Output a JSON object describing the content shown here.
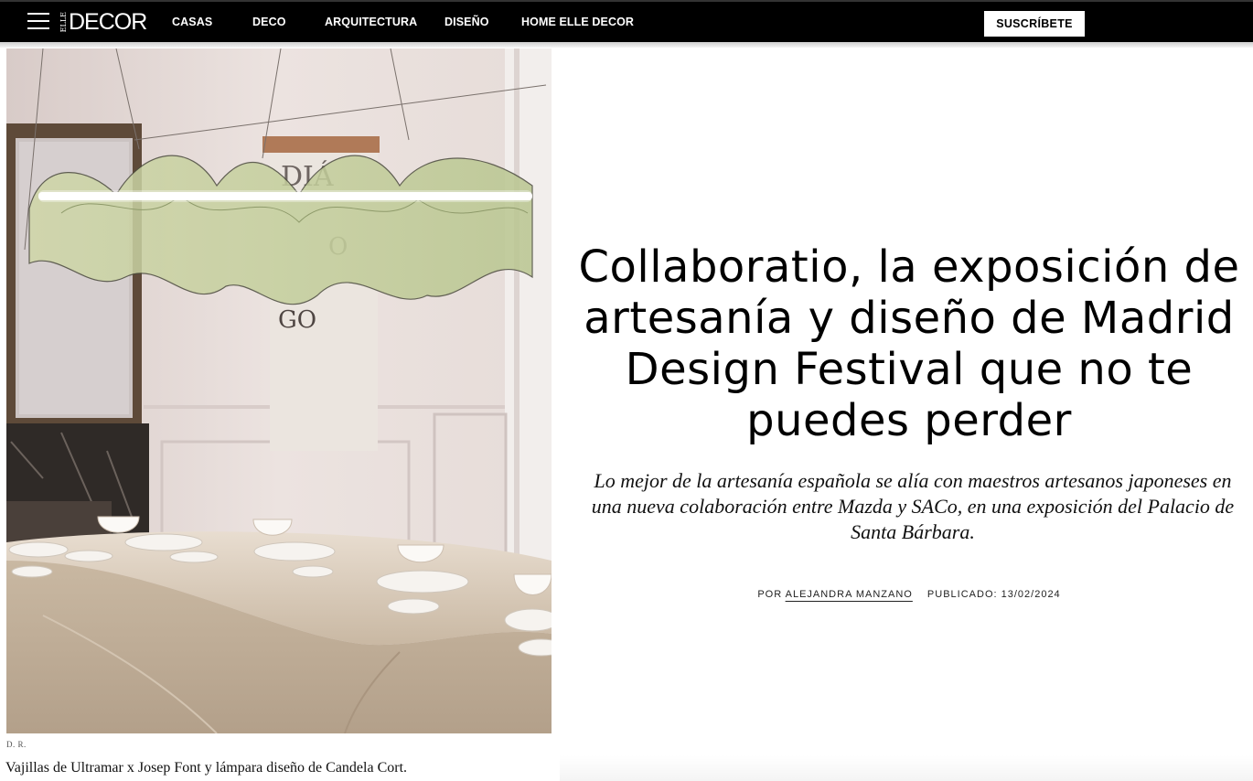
{
  "header": {
    "logo_elle": "ELLE",
    "logo_decor": "DECOR",
    "nav": [
      "CASAS",
      "DECO",
      "ARQUITECTURA",
      "DISEÑO",
      "HOME ELLE DECOR"
    ],
    "subscribe_label": "SUSCRÍBETE",
    "icons": {
      "menu": "hamburger-icon"
    }
  },
  "hero": {
    "sign_text_1": "DIÁ",
    "sign_text_2": "O",
    "sign_text_3": "GO",
    "credit": "D. R.",
    "caption": "Vajillas de Ultramar x Josep Font y lámpara diseño de Candela Cort."
  },
  "article": {
    "title": "Collaboratio, la exposición de artesanía y diseño de Madrid Design Festival que no te puedes perder",
    "dek": "Lo mejor de la artesanía española se alía con maestros artesanos japoneses en una nueva colaboración entre Mazda y SACo, en una exposición del Palacio de Santa Bárbara.",
    "byline_prefix": "POR",
    "author": "ALEJANDRA MANZANO",
    "published_label": "PUBLICADO:",
    "published_date": "13/02/2024"
  },
  "colors": {
    "nav_bg": "#000000",
    "nav_text": "#ffffff",
    "text": "#000000"
  }
}
